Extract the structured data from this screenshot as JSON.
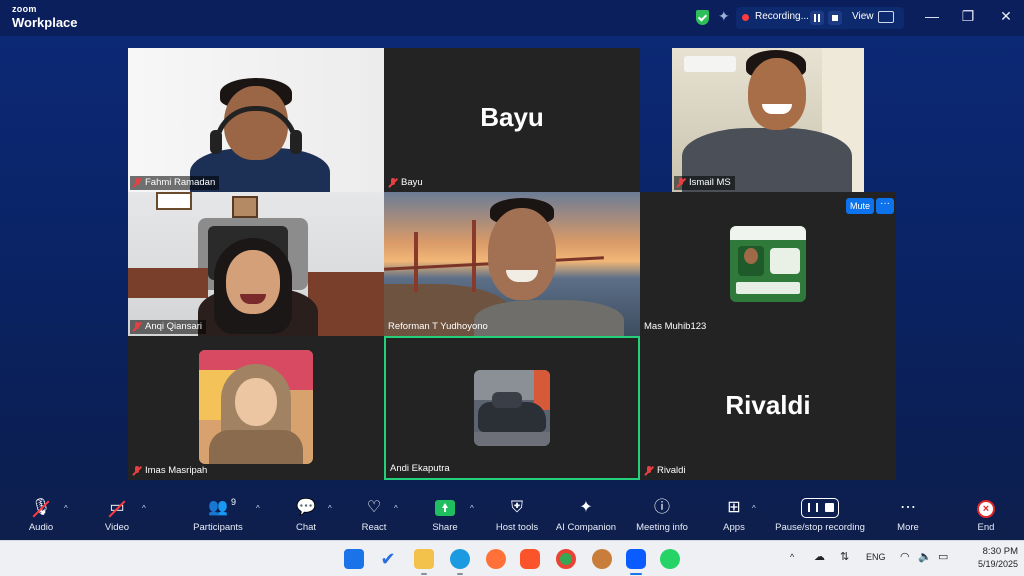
{
  "app": {
    "brand_line1": "zoom",
    "brand_line2": "Workplace"
  },
  "titlebar": {
    "recording_label": "Recording...",
    "view_label": "View",
    "minimize": "—",
    "restore": "❐",
    "close": "✕"
  },
  "participants": [
    {
      "name": "Fahmi Ramadan",
      "muted": true,
      "video": true
    },
    {
      "name": "Bayu",
      "muted": true,
      "video": false,
      "big_name": "Bayu"
    },
    {
      "name": "Ismail MS",
      "muted": true,
      "video": true
    },
    {
      "name": "Anqi Qiansari",
      "muted": true,
      "video": true
    },
    {
      "name": "Reforman T Yudhoyono",
      "muted": false,
      "video": true
    },
    {
      "name": "Mas Muhib123",
      "muted": false,
      "video": false
    },
    {
      "name": "Imas Masripah",
      "muted": true,
      "video": false
    },
    {
      "name": "Andi Ekaputra",
      "muted": false,
      "video": false,
      "active_speaker": true
    },
    {
      "name": "Rivaldi",
      "muted": true,
      "video": false,
      "big_name": "Rivaldi"
    }
  ],
  "tile_actions": {
    "mute_label": "Mute",
    "more_label": "···"
  },
  "toolbar": {
    "audio": "Audio",
    "video": "Video",
    "participants": "Participants",
    "participants_count": "9",
    "chat": "Chat",
    "react": "React",
    "share": "Share",
    "host_tools": "Host tools",
    "ai_companion": "AI Companion",
    "meeting_info": "Meeting info",
    "apps": "Apps",
    "pause_stop_recording": "Pause/stop recording",
    "more": "More",
    "end": "End"
  },
  "taskbar": {
    "language": "ENG",
    "time": "8:30 PM",
    "date": "5/19/2025"
  },
  "colors": {
    "background": "#0b1f5c",
    "active_border": "#25d07a",
    "accent": "#0e72ed",
    "muted_red": "#e84040"
  }
}
